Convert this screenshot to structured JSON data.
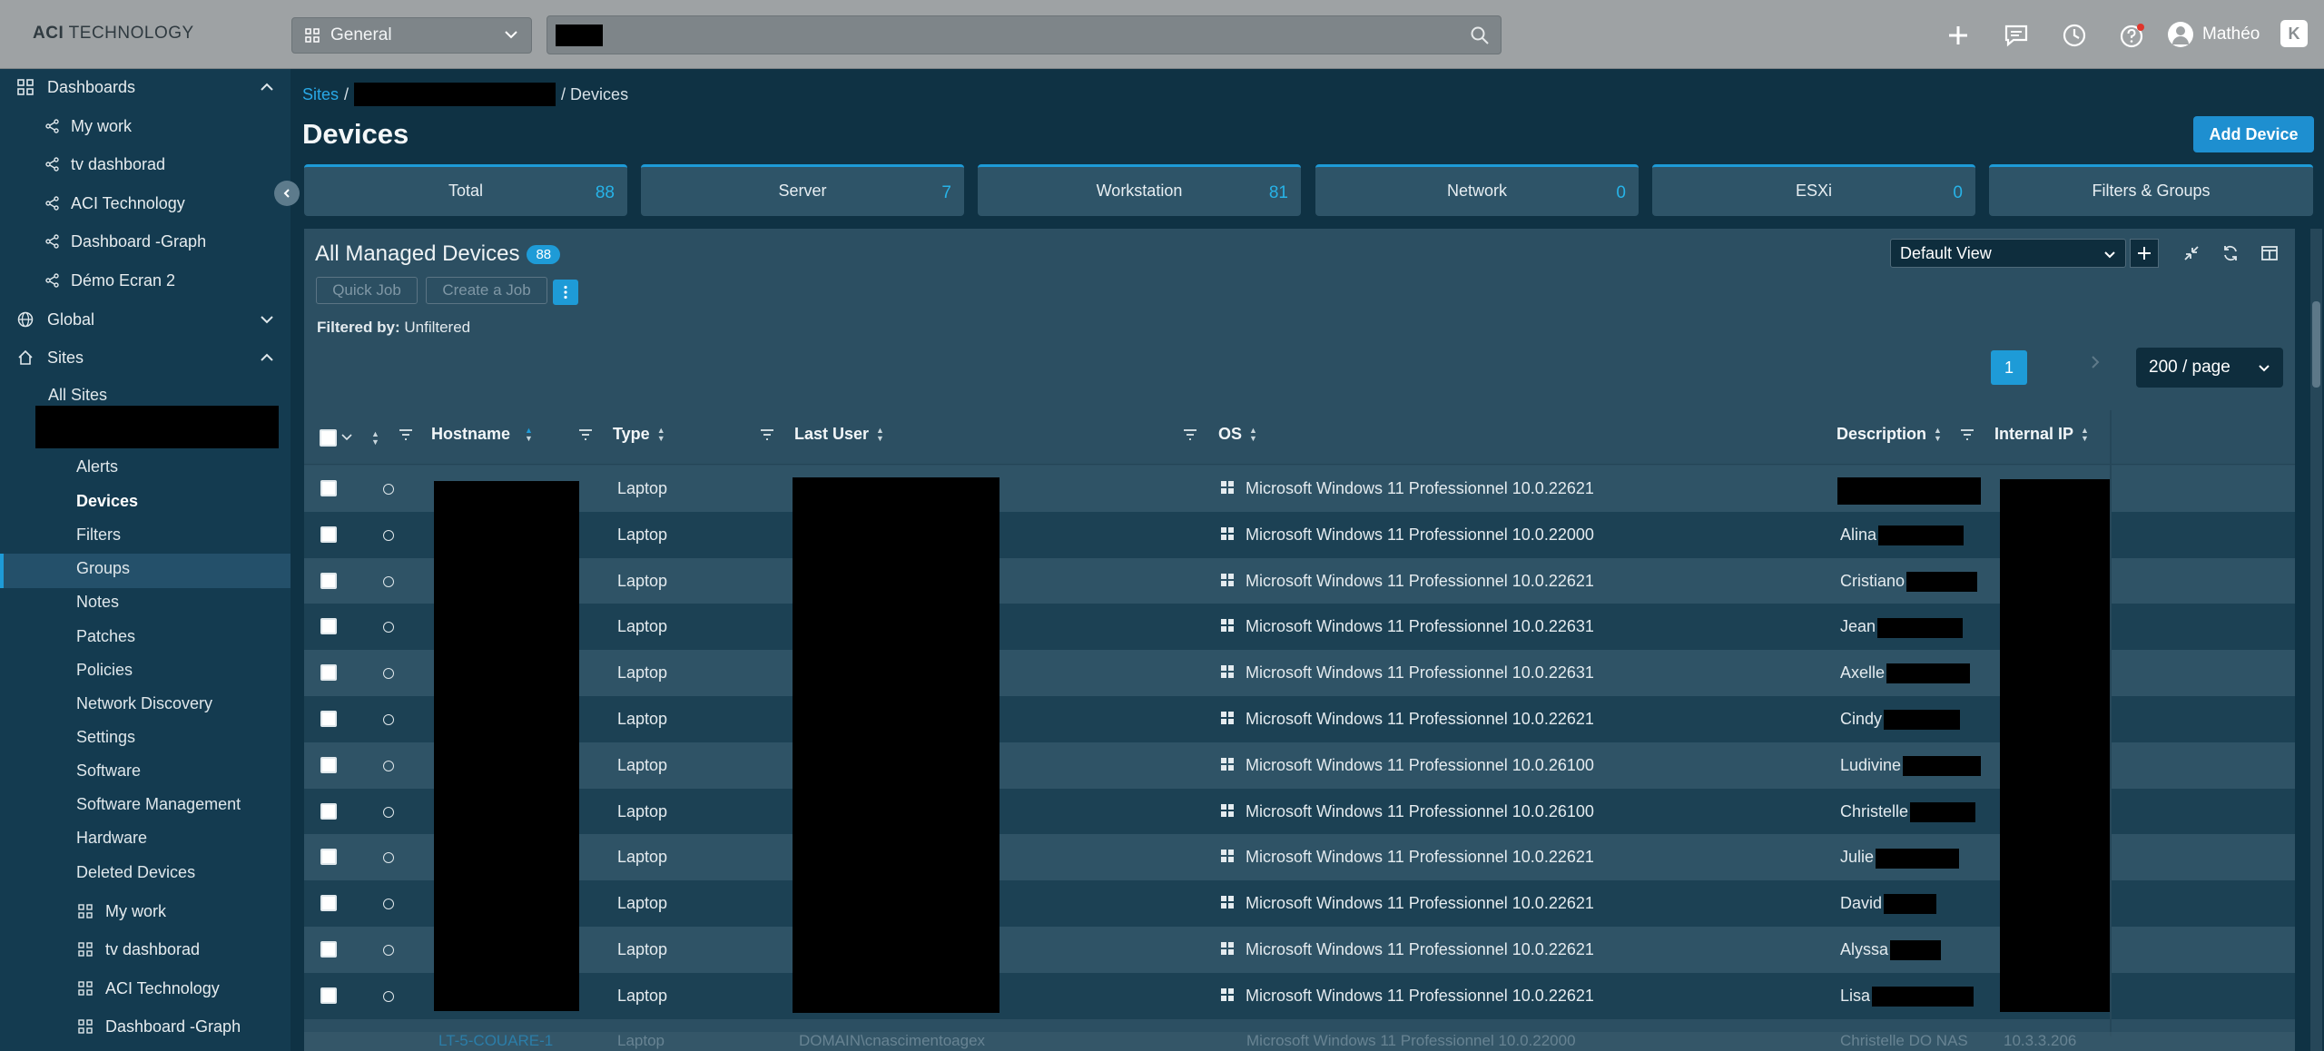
{
  "topbar": {
    "logo_bold": "ACI",
    "logo_rest": " TECHNOLOGY",
    "scope_select": "General",
    "user_name": "Mathéo",
    "corner_label": "K",
    "icons": [
      "plus-icon",
      "chat-icon",
      "clock-icon",
      "help-icon",
      "user-icon"
    ]
  },
  "sidebar": {
    "dashboards_label": "Dashboards",
    "dashboard_items": [
      "My work",
      "tv dashborad",
      "ACI Technology",
      "Dashboard -Graph",
      "Démo Ecran 2"
    ],
    "global_label": "Global",
    "sites_label": "Sites",
    "all_sites_label": "All Sites",
    "site_items": [
      "Alerts",
      "Devices",
      "Filters",
      "Groups",
      "Notes",
      "Patches",
      "Policies",
      "Network Discovery",
      "Settings",
      "Software",
      "Software Management",
      "Hardware",
      "Deleted Devices"
    ],
    "site_dashboards": [
      "My work",
      "tv dashborad",
      "ACI Technology",
      "Dashboard -Graph"
    ]
  },
  "breadcrumb": {
    "root": "Sites",
    "sep": "/",
    "current": "/ Devices"
  },
  "page": {
    "title": "Devices",
    "add_button": "Add Device"
  },
  "stats": [
    {
      "label": "Total",
      "value": "88"
    },
    {
      "label": "Server",
      "value": "7"
    },
    {
      "label": "Workstation",
      "value": "81"
    },
    {
      "label": "Network",
      "value": "0"
    },
    {
      "label": "ESXi",
      "value": "0"
    },
    {
      "label": "Filters & Groups",
      "value": ""
    }
  ],
  "panel": {
    "title": "All Managed Devices",
    "count": "88",
    "quick_job": "Quick Job",
    "create_job": "Create a Job",
    "filtered_label": "Filtered by:",
    "filtered_value": "Unfiltered",
    "view_select": "Default View",
    "page": "1",
    "per_page": "200 / page"
  },
  "table": {
    "headers": [
      "Hostname",
      "Type",
      "Last User",
      "OS",
      "Description",
      "Internal IP"
    ],
    "rows": [
      {
        "type": "Laptop",
        "os": "Microsoft Windows 11 Professionnel 10.0.22621",
        "desc": ""
      },
      {
        "type": "Laptop",
        "os": "Microsoft Windows 11 Professionnel 10.0.22000",
        "desc": "Alina"
      },
      {
        "type": "Laptop",
        "os": "Microsoft Windows 11 Professionnel 10.0.22621",
        "desc": "Cristiano"
      },
      {
        "type": "Laptop",
        "os": "Microsoft Windows 11 Professionnel 10.0.22631",
        "desc": "Jean"
      },
      {
        "type": "Laptop",
        "os": "Microsoft Windows 11 Professionnel 10.0.22631",
        "desc": "Axelle"
      },
      {
        "type": "Laptop",
        "os": "Microsoft Windows 11 Professionnel 10.0.22621",
        "desc": "Cindy"
      },
      {
        "type": "Laptop",
        "os": "Microsoft Windows 11 Professionnel 10.0.26100",
        "desc": "Ludivine"
      },
      {
        "type": "Laptop",
        "os": "Microsoft Windows 11 Professionnel 10.0.26100",
        "desc": "Christelle"
      },
      {
        "type": "Laptop",
        "os": "Microsoft Windows 11 Professionnel 10.0.22621",
        "desc": "Julie"
      },
      {
        "type": "Laptop",
        "os": "Microsoft Windows 11 Professionnel 10.0.22621",
        "desc": "David"
      },
      {
        "type": "Laptop",
        "os": "Microsoft Windows 11 Professionnel 10.0.22621",
        "desc": "Alyssa"
      },
      {
        "type": "Laptop",
        "os": "Microsoft Windows 11 Professionnel 10.0.22621",
        "desc": "Lisa"
      }
    ],
    "partial_row": {
      "hostname": "LT-5-COUARE-1",
      "type": "Laptop",
      "user": "DOMAIN\\cnascimentoagex",
      "os": "Microsoft Windows 11 Professionnel 10.0.22000",
      "desc": "Christelle DO NAS",
      "ip": "10.3.3.206"
    }
  },
  "colors": {
    "accent": "#1e9bd7",
    "topbar": "#9ea2a4",
    "sidebar": "#143b50"
  }
}
